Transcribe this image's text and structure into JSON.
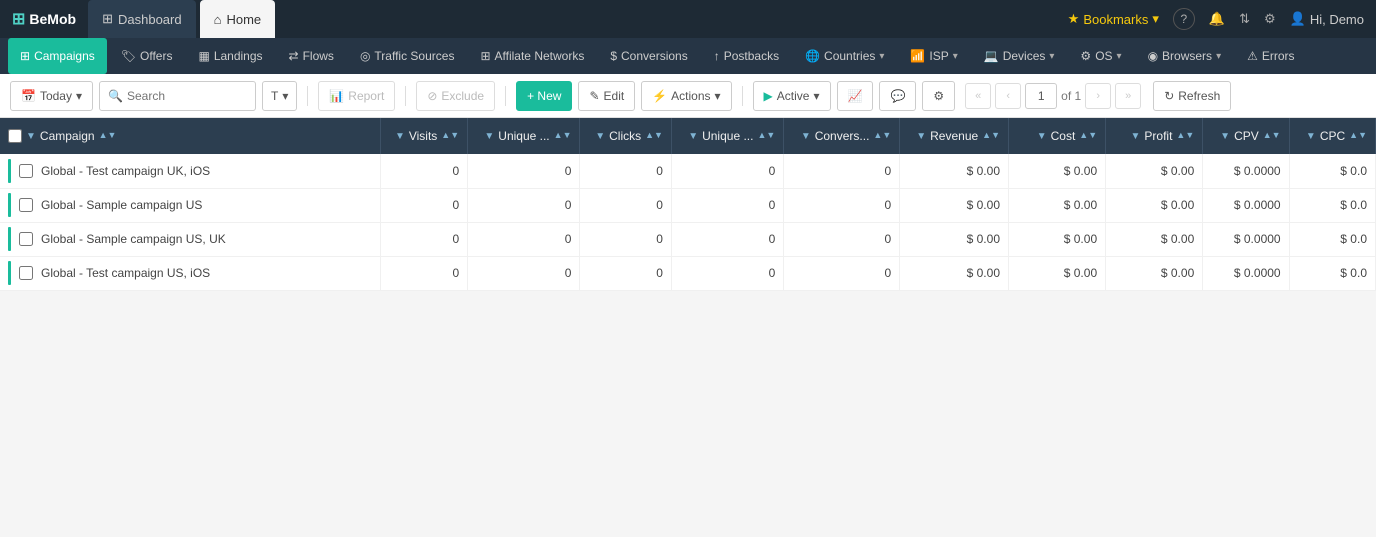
{
  "topNav": {
    "logo": "BeMob",
    "tabs": [
      {
        "id": "dashboard",
        "label": "Dashboard",
        "icon": "grid",
        "active": false
      },
      {
        "id": "home",
        "label": "Home",
        "icon": "home",
        "active": true
      }
    ],
    "bookmarks": "Bookmarks",
    "helpIcon": "?",
    "notifIcon": "bell",
    "settingsIcon": "gear",
    "user": "Hi, Demo"
  },
  "secondNav": {
    "items": [
      {
        "id": "campaigns",
        "label": "Campaigns",
        "icon": "grid",
        "active": true
      },
      {
        "id": "offers",
        "label": "Offers",
        "icon": "tag"
      },
      {
        "id": "landings",
        "label": "Landings",
        "icon": "layout"
      },
      {
        "id": "flows",
        "label": "Flows",
        "icon": "shuffle"
      },
      {
        "id": "traffic-sources",
        "label": "Traffic Sources",
        "icon": "wifi"
      },
      {
        "id": "affiliate-networks",
        "label": "Affilate Networks",
        "icon": "network"
      },
      {
        "id": "conversions",
        "label": "Conversions",
        "icon": "dollar"
      },
      {
        "id": "postbacks",
        "label": "Postbacks",
        "icon": "upload"
      },
      {
        "id": "countries",
        "label": "Countries",
        "icon": "globe",
        "hasChevron": true
      },
      {
        "id": "isp",
        "label": "ISP",
        "icon": "wifi",
        "hasChevron": true
      },
      {
        "id": "devices",
        "label": "Devices",
        "icon": "monitor",
        "hasChevron": true
      },
      {
        "id": "os",
        "label": "OS",
        "icon": "cpu",
        "hasChevron": true
      },
      {
        "id": "browsers",
        "label": "Browsers",
        "icon": "browser",
        "hasChevron": true
      },
      {
        "id": "errors",
        "label": "Errors",
        "icon": "alert"
      }
    ]
  },
  "toolbar": {
    "date_label": "Today",
    "search_placeholder": "Search",
    "t_label": "T",
    "report_label": "Report",
    "exclude_label": "Exclude",
    "new_label": "+ New",
    "edit_label": "Edit",
    "actions_label": "Actions",
    "active_label": "Active",
    "refresh_label": "Refresh",
    "page_current": "1",
    "page_total": "of 1"
  },
  "table": {
    "columns": [
      {
        "id": "campaign",
        "label": "Campaign",
        "sortable": true,
        "filterable": true
      },
      {
        "id": "visits",
        "label": "Visits",
        "sortable": true,
        "filterable": true
      },
      {
        "id": "unique1",
        "label": "Unique ...",
        "sortable": true,
        "filterable": true
      },
      {
        "id": "clicks",
        "label": "Clicks",
        "sortable": true,
        "filterable": true
      },
      {
        "id": "unique2",
        "label": "Unique ...",
        "sortable": true,
        "filterable": true
      },
      {
        "id": "conversions",
        "label": "Convers...",
        "sortable": true,
        "filterable": true
      },
      {
        "id": "revenue",
        "label": "Revenue",
        "sortable": true,
        "filterable": true
      },
      {
        "id": "cost",
        "label": "Cost",
        "sortable": true,
        "filterable": true
      },
      {
        "id": "profit",
        "label": "Profit",
        "sortable": true,
        "filterable": true
      },
      {
        "id": "cpv",
        "label": "CPV",
        "sortable": true,
        "filterable": true
      },
      {
        "id": "cpc",
        "label": "CPC",
        "sortable": true,
        "filterable": true
      }
    ],
    "rows": [
      {
        "id": 1,
        "campaign": "Global - Test campaign UK, iOS",
        "visits": "0",
        "unique1": "0",
        "clicks": "0",
        "unique2": "0",
        "conversions": "0",
        "revenue": "$ 0.00",
        "cost": "$ 0.00",
        "profit": "$ 0.00",
        "cpv": "$ 0.0000",
        "cpc": "$ 0.0"
      },
      {
        "id": 2,
        "campaign": "Global - Sample campaign US",
        "visits": "0",
        "unique1": "0",
        "clicks": "0",
        "unique2": "0",
        "conversions": "0",
        "revenue": "$ 0.00",
        "cost": "$ 0.00",
        "profit": "$ 0.00",
        "cpv": "$ 0.0000",
        "cpc": "$ 0.0"
      },
      {
        "id": 3,
        "campaign": "Global - Sample campaign US, UK",
        "visits": "0",
        "unique1": "0",
        "clicks": "0",
        "unique2": "0",
        "conversions": "0",
        "revenue": "$ 0.00",
        "cost": "$ 0.00",
        "profit": "$ 0.00",
        "cpv": "$ 0.0000",
        "cpc": "$ 0.0"
      },
      {
        "id": 4,
        "campaign": "Global - Test campaign US, iOS",
        "visits": "0",
        "unique1": "0",
        "clicks": "0",
        "unique2": "0",
        "conversions": "0",
        "revenue": "$ 0.00",
        "cost": "$ 0.00",
        "profit": "$ 0.00",
        "cpv": "$ 0.0000",
        "cpc": "$ 0.0"
      }
    ]
  },
  "colors": {
    "topNavBg": "#1e2a35",
    "secondNavBg": "#263545",
    "activeCampaign": "#1abc9c",
    "tableHeader": "#2c3e50"
  }
}
